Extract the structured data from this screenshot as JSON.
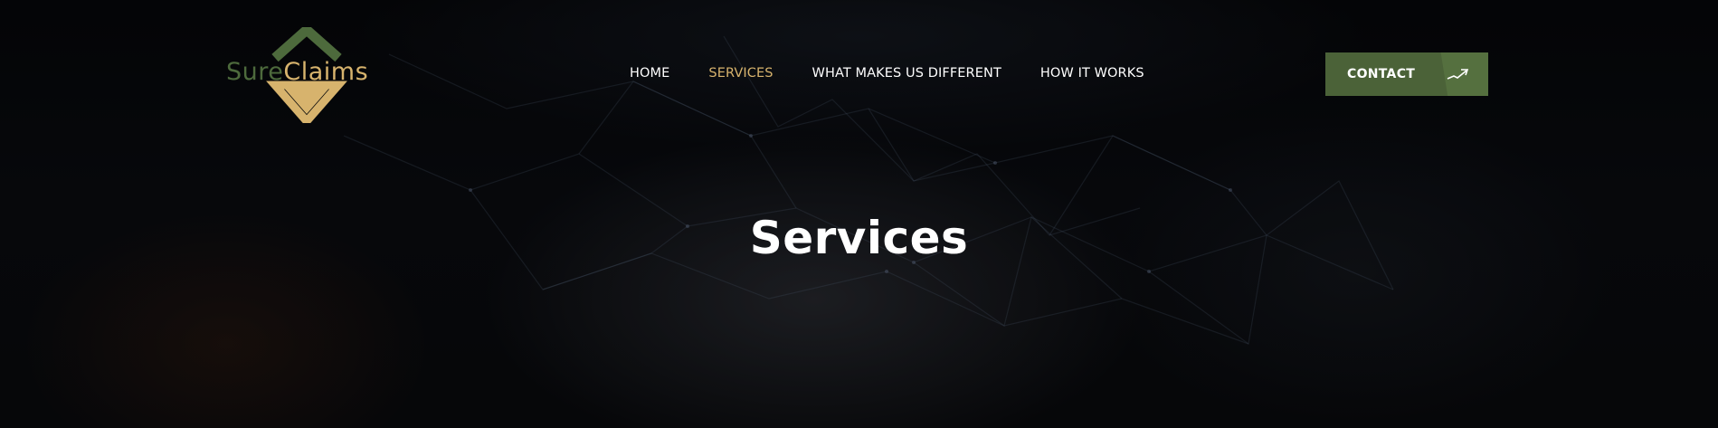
{
  "brand": {
    "name_part1": "Sure",
    "name_part2": "Claims",
    "color_primary": "#4d6a3c",
    "color_accent": "#d7b36d"
  },
  "nav": {
    "items": [
      {
        "label": "HOME",
        "active": false
      },
      {
        "label": "SERVICES",
        "active": true
      },
      {
        "label": "WHAT MAKES US DIFFERENT",
        "active": false
      },
      {
        "label": "HOW IT WORKS",
        "active": false
      }
    ]
  },
  "contact_button": {
    "label": "CONTACT",
    "icon": "arrow-trend-icon",
    "color": "#4b6238"
  },
  "hero": {
    "title": "Services"
  }
}
